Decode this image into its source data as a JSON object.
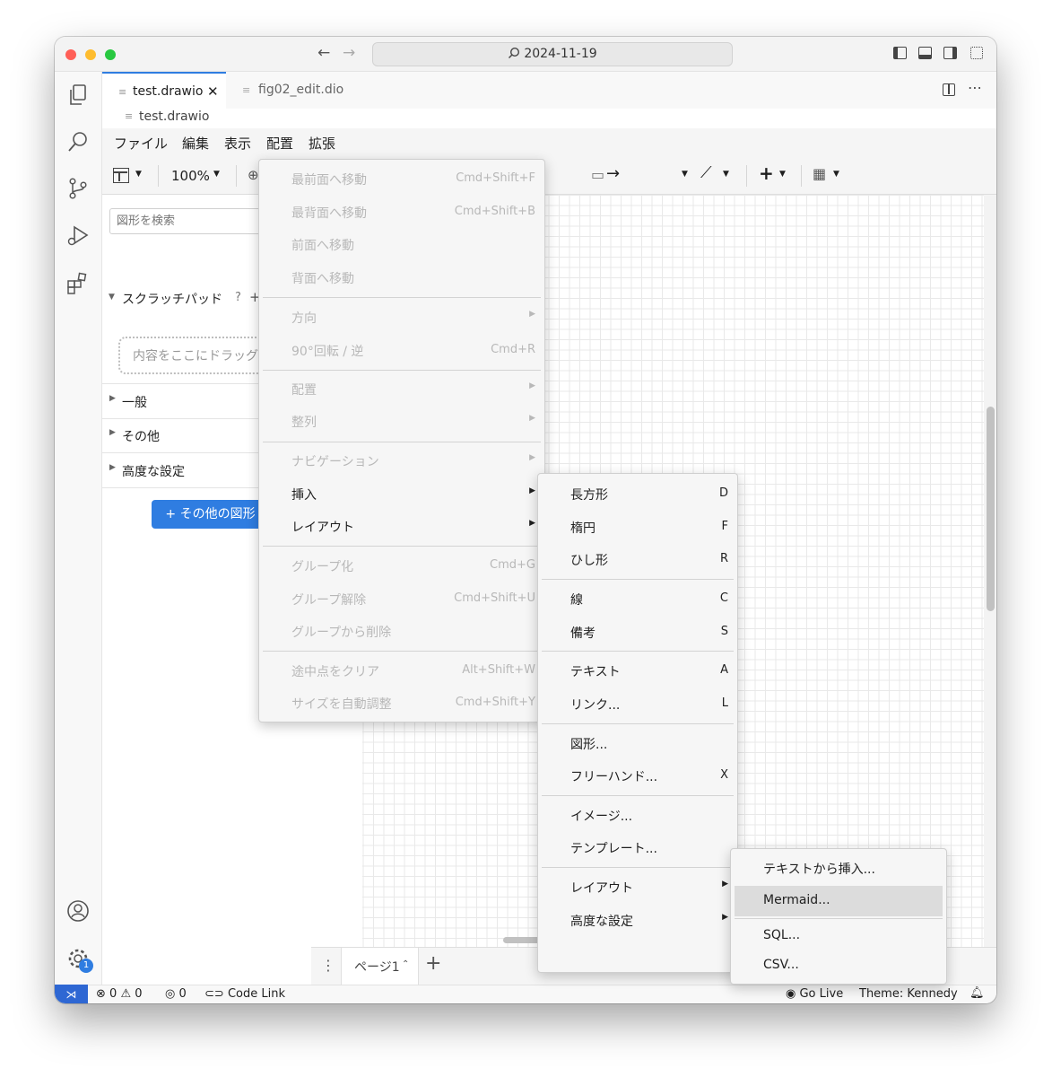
{
  "titlebar": {
    "search_text": "2024-11-19",
    "back_icon": "arrow-left-icon",
    "forward_icon": "arrow-right-icon"
  },
  "tabs": [
    {
      "label": "test.drawio",
      "active": true
    },
    {
      "label": "fig02_edit.dio",
      "active": false
    }
  ],
  "breadcrumb": {
    "file": "test.drawio"
  },
  "menubar": [
    "ファイル",
    "編集",
    "表示",
    "配置",
    "拡張"
  ],
  "toolbar": {
    "zoom": "100%"
  },
  "sidebar": {
    "search_placeholder": "図形を検索",
    "scratchpad_title": "スクラッチパッド",
    "scratchpad_help": "?",
    "scratchpad_add": "+",
    "drop_hint": "内容をここにドラッグ",
    "sections": [
      "一般",
      "その他",
      "高度な設定"
    ],
    "more_shapes_button": "+ その他の図形"
  },
  "arrange_menu": {
    "items": [
      {
        "label": "最前面へ移動",
        "shortcut": "Cmd+Shift+F"
      },
      {
        "label": "最背面へ移動",
        "shortcut": "Cmd+Shift+B"
      },
      {
        "label": "前面へ移動",
        "shortcut": ""
      },
      {
        "label": "背面へ移動",
        "shortcut": ""
      },
      {
        "label": "方向",
        "shortcut": ""
      },
      {
        "label": "90°回転 / 逆",
        "shortcut": "Cmd+R"
      },
      {
        "label": "配置",
        "shortcut": ""
      },
      {
        "label": "整列",
        "shortcut": ""
      },
      {
        "label": "ナビゲーション",
        "shortcut": ""
      },
      {
        "label": "挿入",
        "shortcut": ""
      },
      {
        "label": "レイアウト",
        "shortcut": ""
      },
      {
        "label": "グループ化",
        "shortcut": "Cmd+G"
      },
      {
        "label": "グループ解除",
        "shortcut": "Cmd+Shift+U"
      },
      {
        "label": "グループから削除",
        "shortcut": ""
      },
      {
        "label": "途中点をクリア",
        "shortcut": "Alt+Shift+W"
      },
      {
        "label": "サイズを自動調整",
        "shortcut": "Cmd+Shift+Y"
      }
    ]
  },
  "insert_menu": {
    "items": [
      {
        "label": "長方形",
        "shortcut": "D"
      },
      {
        "label": "楕円",
        "shortcut": "F"
      },
      {
        "label": "ひし形",
        "shortcut": "R"
      },
      {
        "label": "線",
        "shortcut": "C"
      },
      {
        "label": "備考",
        "shortcut": "S"
      },
      {
        "label": "テキスト",
        "shortcut": "A"
      },
      {
        "label": "リンク...",
        "shortcut": "L"
      },
      {
        "label": "図形...",
        "shortcut": ""
      },
      {
        "label": "フリーハンド...",
        "shortcut": "X"
      },
      {
        "label": "イメージ...",
        "shortcut": ""
      },
      {
        "label": "テンプレート...",
        "shortcut": ""
      },
      {
        "label": "レイアウト",
        "shortcut": ""
      },
      {
        "label": "高度な設定",
        "shortcut": ""
      }
    ]
  },
  "advanced_menu": {
    "items": [
      {
        "label": "テキストから挿入..."
      },
      {
        "label": "Mermaid..."
      },
      {
        "label": "SQL..."
      },
      {
        "label": "CSV..."
      }
    ],
    "highlighted": "Mermaid..."
  },
  "pages": {
    "current": "ページ1",
    "add": "+"
  },
  "statusbar": {
    "errors": "0",
    "warnings": "0",
    "ports": "0",
    "code_link": "Code Link",
    "go_live": "Go Live",
    "theme": "Theme: Kennedy",
    "settings_badge": "1"
  },
  "colors": {
    "accent": "#2f7de1",
    "status_remote": "#2e67d3",
    "highlight": "#dcdcdc"
  }
}
